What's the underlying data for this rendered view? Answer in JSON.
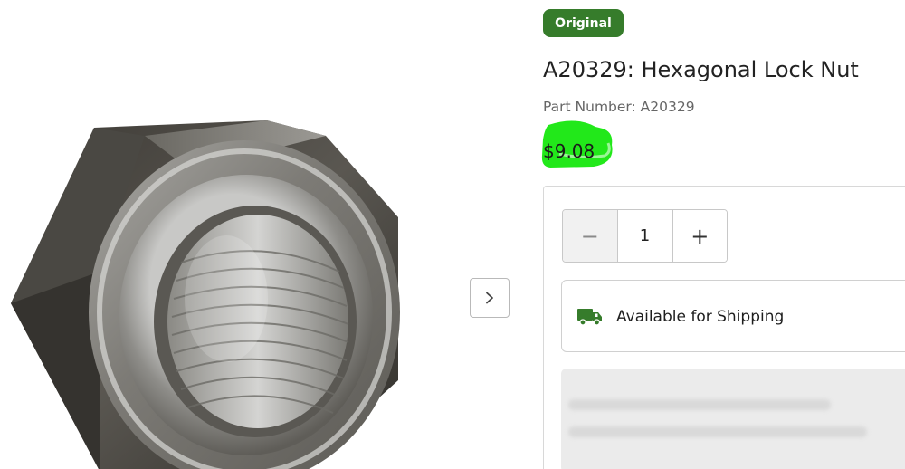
{
  "product": {
    "badge": "Original",
    "title": "A20329: Hexagonal Lock Nut",
    "part_number_text": "Part Number: A20329",
    "price": "$9.08",
    "image_alt": "Hexagonal Lock Nut product image"
  },
  "purchase": {
    "quantity": "1",
    "minus_symbol": "−",
    "plus_symbol": "+",
    "availability": "Available for Shipping"
  },
  "icons": {
    "next": "chevron-right-icon",
    "truck": "delivery-truck-icon"
  },
  "colors": {
    "brand_green": "#367c2b",
    "highlight": "#22e81a"
  }
}
